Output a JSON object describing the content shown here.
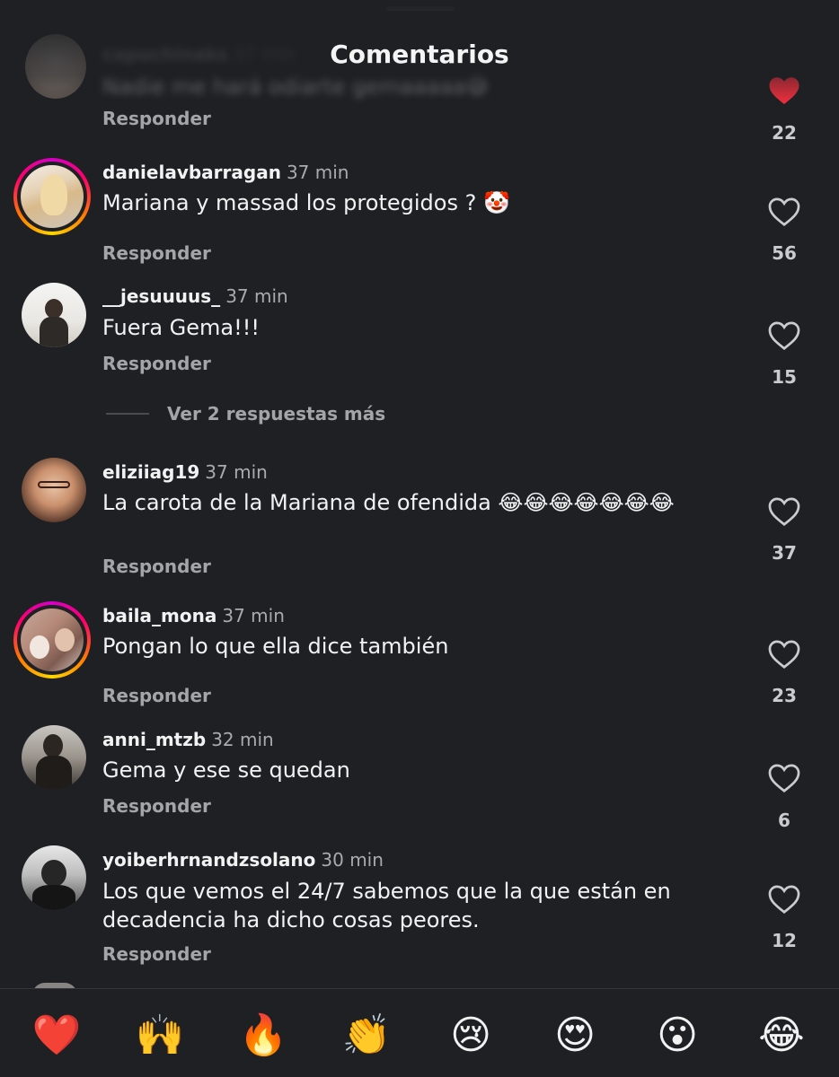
{
  "header": {
    "title": "Comentarios"
  },
  "first_comment": {
    "username": "capuchinaks",
    "time": "37 min",
    "text": "Nadie me hará odiarte gemaaaaa😅",
    "reply_label": "Responder",
    "likes": "22",
    "liked": true
  },
  "comments": [
    {
      "username": "danielavbarragan",
      "time": "37 min",
      "text": "Mariana y massad los protegidos ? 🤡",
      "reply_label": "Responder",
      "likes": "56",
      "story_ring": true
    },
    {
      "username": "__jesuuuus_",
      "time": "37 min",
      "text": "Fuera Gema!!!",
      "reply_label": "Responder",
      "likes": "15",
      "story_ring": false
    },
    {
      "username": "eliziiag19",
      "time": "37 min",
      "text": "La carota de la Mariana de ofendida 😂😂😂😂😂😂😂",
      "reply_label": "Responder",
      "likes": "37",
      "story_ring": false
    },
    {
      "username": "baila_mona",
      "time": "37 min",
      "text": "Pongan lo que ella dice también",
      "reply_label": "Responder",
      "likes": "23",
      "story_ring": true
    },
    {
      "username": "anni_mtzb",
      "time": "32 min",
      "text": "Gema y ese se quedan",
      "reply_label": "Responder",
      "likes": "6",
      "story_ring": false
    },
    {
      "username": "yoiberhrnandzsolano",
      "time": "30 min",
      "text": "Los que vemos el 24/7 sabemos que la que están en decadencia ha dicho cosas peores.",
      "reply_label": "Responder",
      "likes": "12",
      "story_ring": false
    }
  ],
  "more_replies": {
    "label": "Ver 2 respuestas más"
  },
  "reaction_bar": {
    "emojis": [
      "❤️",
      "🙌",
      "🔥",
      "👏",
      "😢",
      "😍",
      "😮",
      "😂"
    ]
  },
  "colors": {
    "background": "#1e2023",
    "liked_heart": "#ff3040",
    "story_ring": [
      "#d300c5",
      "#ff0069",
      "#ff7a00",
      "#ffd600"
    ]
  }
}
